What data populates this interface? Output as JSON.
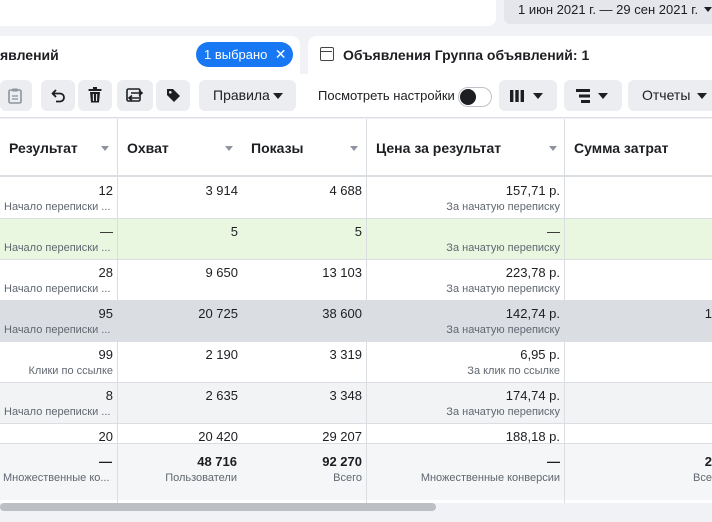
{
  "date_range": "1 июн 2021 г. — 29 сен 2021 г.",
  "tabs": {
    "ads_label": "явлений",
    "selected_pill": "1 выбрано",
    "group_label": "Объявления Группа объявлений: 1"
  },
  "toolbar": {
    "rules_label": "Правила",
    "view_settings_label": "Посмотреть настройки",
    "reports_label": "Отчеты",
    "icons": [
      "clipboard-icon",
      "undo-icon",
      "trash-icon",
      "swap-icon",
      "tag-icon",
      "columns-icon",
      "breakdown-icon"
    ]
  },
  "table": {
    "headers": [
      "Результат",
      "Охват",
      "Показы",
      "Цена за результат",
      "Сумма затрат"
    ],
    "rows": [
      {
        "result": "12",
        "result_sub": "Начало переписки ...",
        "reach": "3 914",
        "impressions": "4 688",
        "cost": "157,71 р.",
        "cost_sub": "За начатую переписку",
        "spend": ""
      },
      {
        "result": "—",
        "result_sub": "Начало переписки ...",
        "reach": "5",
        "impressions": "5",
        "cost": "—",
        "cost_sub": "За начатую переписку",
        "spend": ""
      },
      {
        "result": "28",
        "result_sub": "Начало переписки ...",
        "reach": "9 650",
        "impressions": "13 103",
        "cost": "223,78 р.",
        "cost_sub": "За начатую переписку",
        "spend": ""
      },
      {
        "result": "95",
        "result_sub": "Начало переписки ...",
        "reach": "20 725",
        "impressions": "38 600",
        "cost": "142,74 р.",
        "cost_sub": "За начатую переписку",
        "spend": "1"
      },
      {
        "result": "99",
        "result_sub": "Клики по ссылке",
        "reach": "2 190",
        "impressions": "3 319",
        "cost": "6,95 р.",
        "cost_sub": "За клик по ссылке",
        "spend": ""
      },
      {
        "result": "8",
        "result_sub": "Начало переписки ...",
        "reach": "2 635",
        "impressions": "3 348",
        "cost": "174,74 р.",
        "cost_sub": "За начатую переписку",
        "spend": ""
      },
      {
        "result": "20",
        "result_sub": "",
        "reach": "20 420",
        "impressions": "29 207",
        "cost": "188,18 р.",
        "cost_sub": "",
        "spend": ""
      }
    ],
    "row_backgrounds": [
      "#ffffff",
      "#e9f7e1",
      "#ffffff",
      "#dadde1",
      "#ffffff",
      "#f2f3f5",
      "#ffffff"
    ],
    "totals": {
      "result": "—",
      "result_sub": "Множественные ко...",
      "reach": "48 716",
      "reach_sub": "Пользователи",
      "impressions": "92 270",
      "impressions_sub": "Всего",
      "cost": "—",
      "cost_sub": "Множественные конверсии",
      "spend": "2",
      "spend_sub": "Все"
    }
  }
}
